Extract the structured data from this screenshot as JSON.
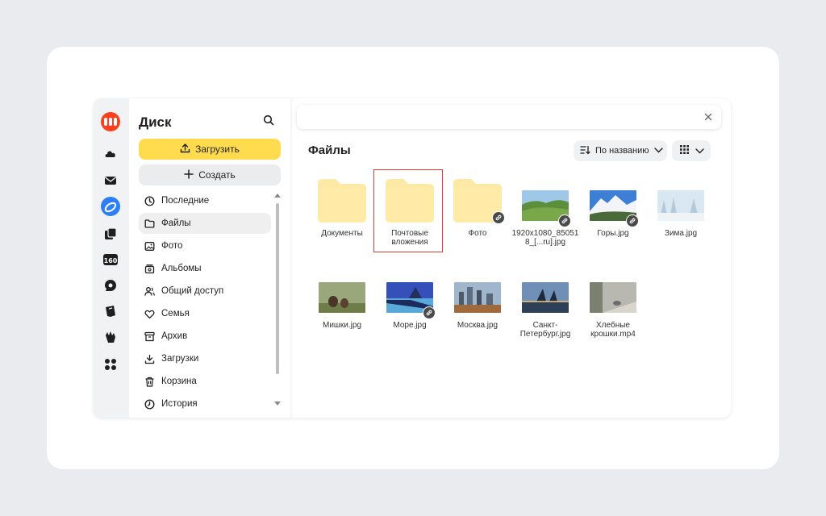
{
  "sidebar": {
    "title": "Диск",
    "upload_label": "Загрузить",
    "create_label": "Создать",
    "items": [
      {
        "label": "Последние",
        "icon": "clock-icon",
        "active": false
      },
      {
        "label": "Файлы",
        "icon": "folder-icon",
        "active": true
      },
      {
        "label": "Фото",
        "icon": "image-icon",
        "active": false
      },
      {
        "label": "Альбомы",
        "icon": "albums-icon",
        "active": false
      },
      {
        "label": "Общий доступ",
        "icon": "shared-icon",
        "active": false
      },
      {
        "label": "Семья",
        "icon": "family-icon",
        "active": false
      },
      {
        "label": "Архив",
        "icon": "archive-icon",
        "active": false
      },
      {
        "label": "Загрузки",
        "icon": "download-icon",
        "active": false
      },
      {
        "label": "Корзина",
        "icon": "trash-icon",
        "active": false
      },
      {
        "label": "История",
        "icon": "history-icon",
        "active": false
      }
    ]
  },
  "rail": {
    "badge_text": "160",
    "icons": [
      "yandex-logo-icon",
      "cloud-icon",
      "mail-icon",
      "disk-icon",
      "docs-icon",
      "calendar-icon",
      "messenger-icon",
      "notes-icon",
      "telemost-icon",
      "apps-grid-icon"
    ]
  },
  "main": {
    "title": "Файлы",
    "sort_label": "По названию",
    "view_icon": "grid-view-icon",
    "selected_item": "Почтовые вложения"
  },
  "files": [
    {
      "name": "Документы",
      "kind": "folder",
      "shared": false
    },
    {
      "name": "Почтовые вложения",
      "kind": "folder",
      "shared": false
    },
    {
      "name": "Фото",
      "kind": "folder",
      "shared": true
    },
    {
      "name": "1920x1080_850518_[...ru].jpg",
      "kind": "image",
      "shared": true,
      "scene": "green-hills"
    },
    {
      "name": "Горы.jpg",
      "kind": "image",
      "shared": true,
      "scene": "snowy-mountains"
    },
    {
      "name": "Зима.jpg",
      "kind": "image",
      "shared": false,
      "scene": "winter-forest"
    },
    {
      "name": "Мишки.jpg",
      "kind": "image",
      "shared": false,
      "scene": "bears"
    },
    {
      "name": "Море.jpg",
      "kind": "image",
      "shared": true,
      "scene": "sea-pier"
    },
    {
      "name": "Москва.jpg",
      "kind": "image",
      "shared": false,
      "scene": "moscow-city"
    },
    {
      "name": "Санкт-Петербург.jpg",
      "kind": "image",
      "shared": false,
      "scene": "bridge-night"
    },
    {
      "name": "Хлебные крошки.mp4",
      "kind": "video",
      "shared": false,
      "scene": "pigeons"
    }
  ],
  "colors": {
    "accent_yellow": "#ffdb4d",
    "logo_red": "#fc3f1d",
    "disk_blue": "#2d7ff9",
    "folder_yellow": "#ffe7a3",
    "highlight_red": "#e53935"
  }
}
